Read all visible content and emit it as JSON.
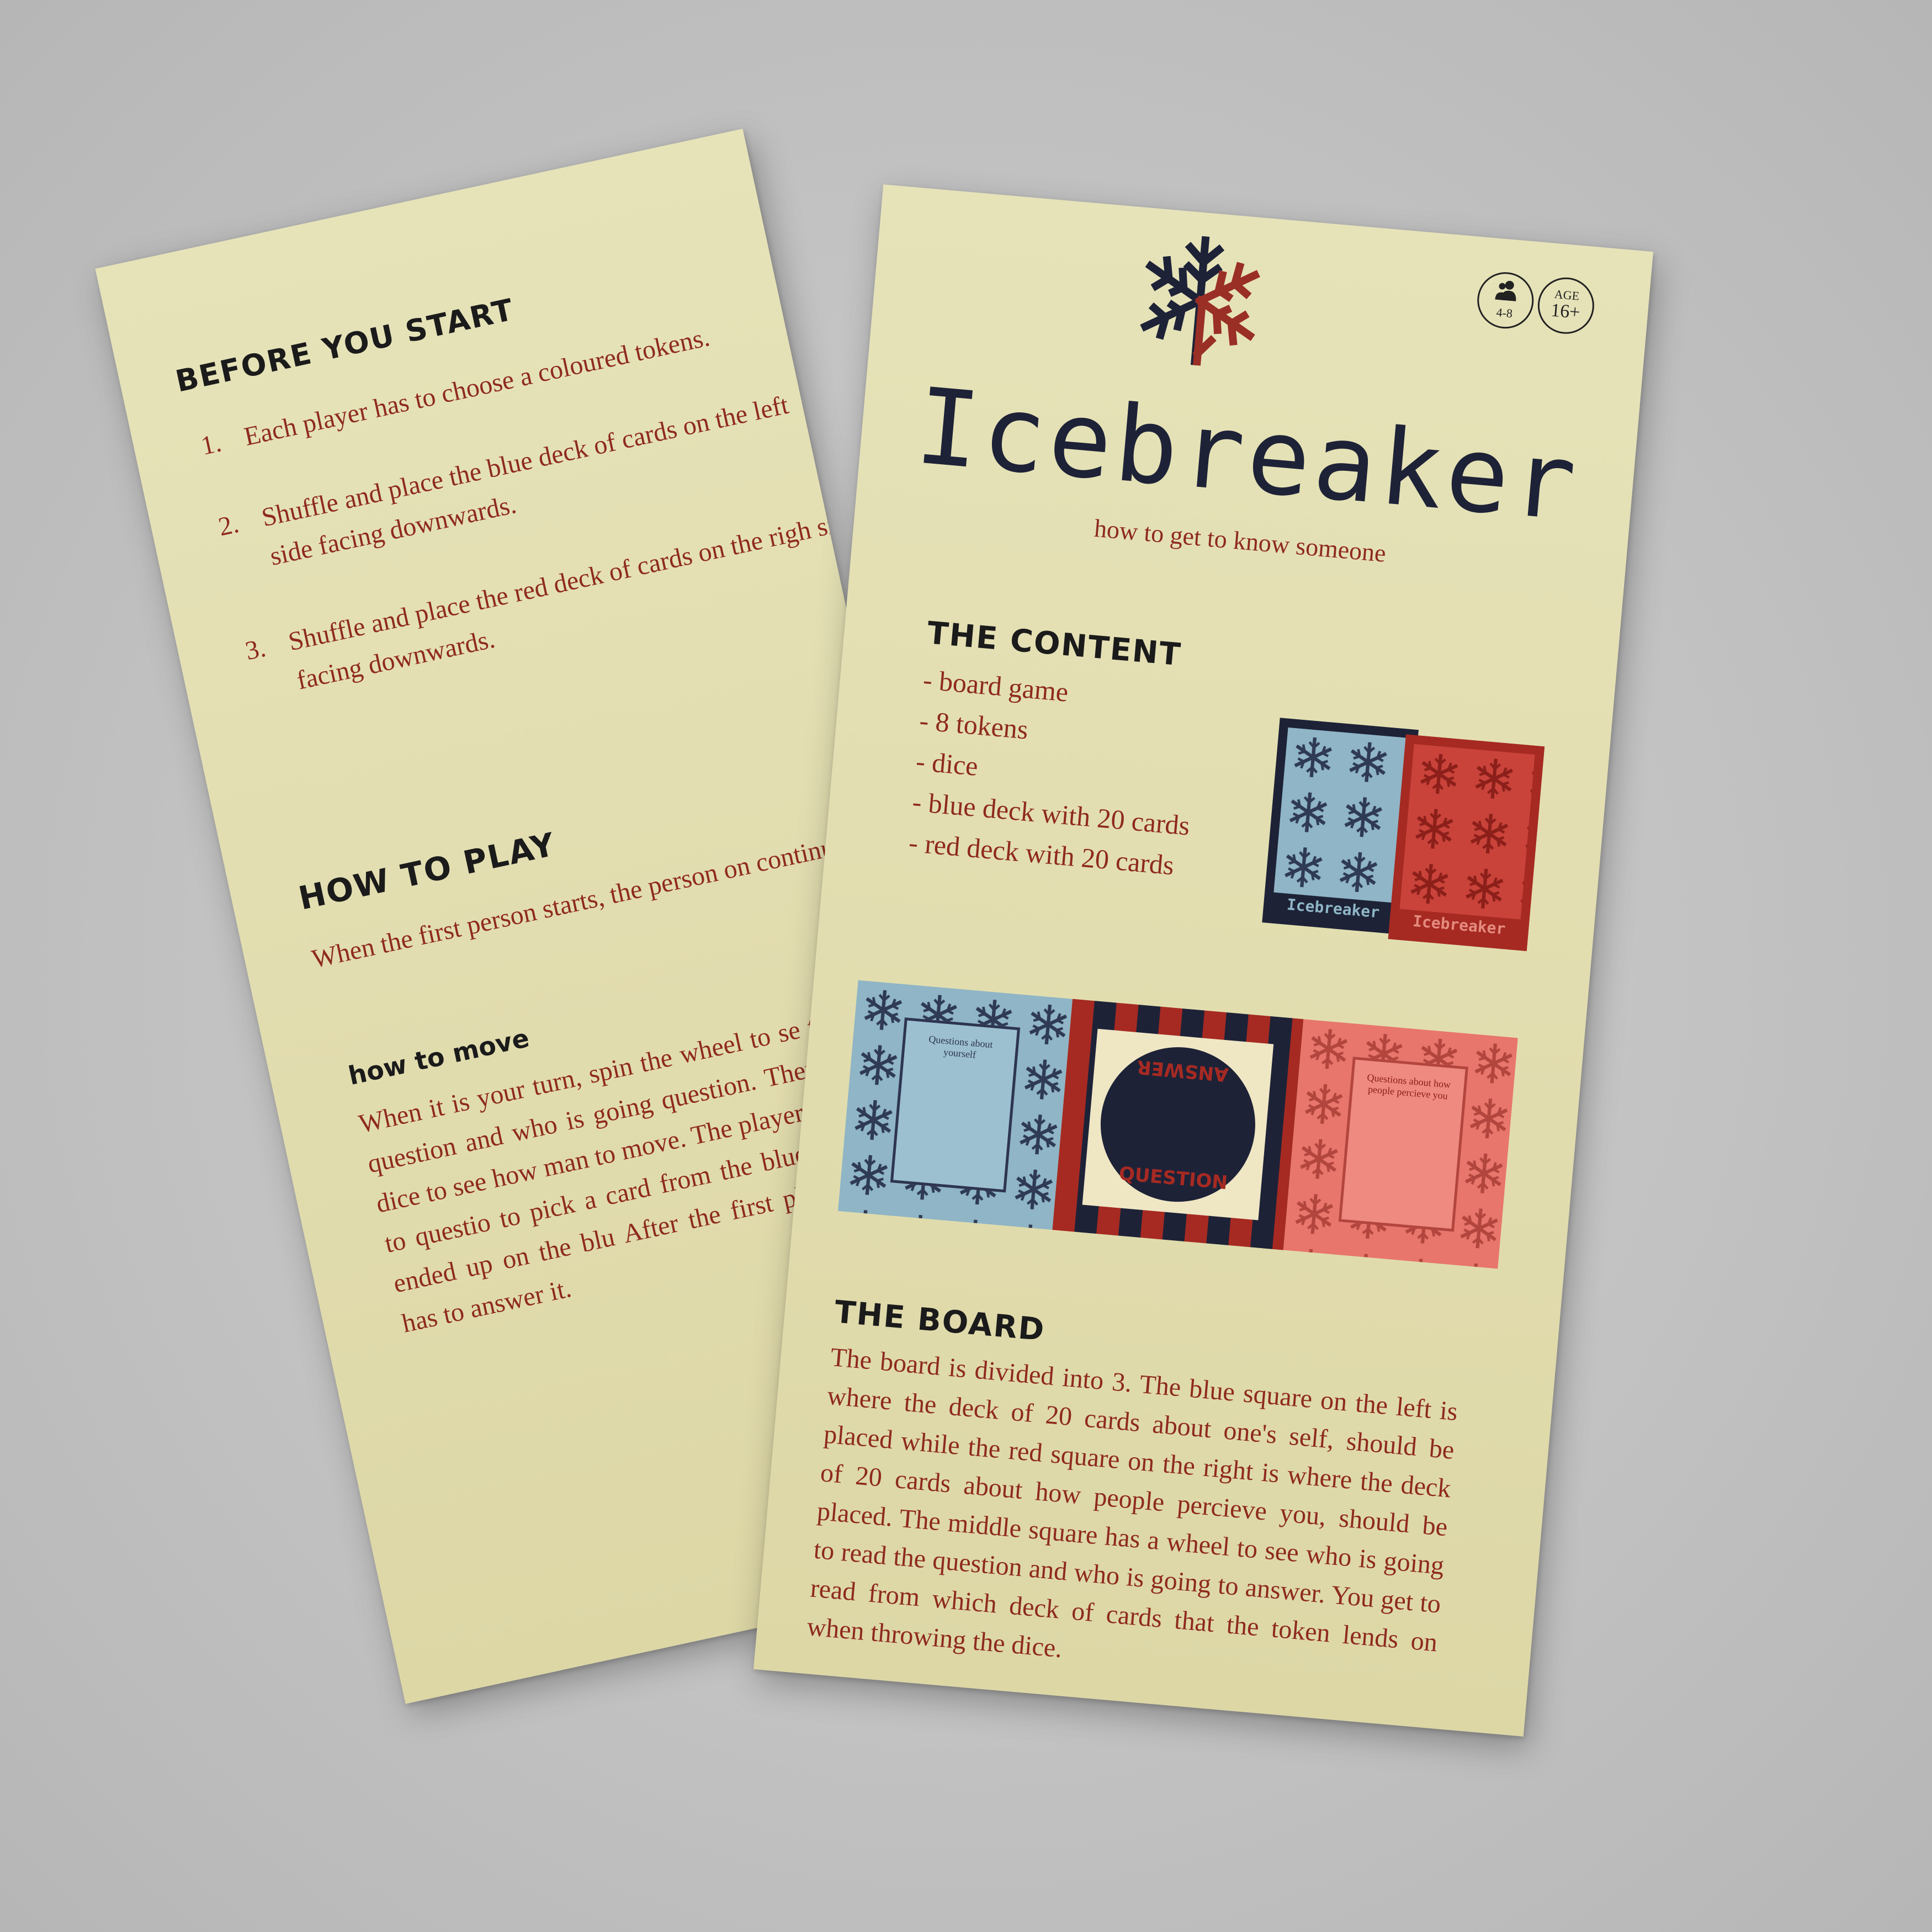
{
  "colors": {
    "background": "#c4c4c4",
    "paper": "#e3dfb3",
    "accent_red": "#8e2a1f",
    "navy": "#1d2237",
    "card_blue": "#8fb5c6",
    "card_red": "#c9433a",
    "board_pink": "#e8766c"
  },
  "back_card": {
    "before_title": "BEFORE YOU START",
    "before_items": [
      {
        "num": "1.",
        "text": "Each player has to choose a coloured tokens."
      },
      {
        "num": "2.",
        "text": "Shuffle and place the blue deck of cards on the left side facing downwards."
      },
      {
        "num": "3.",
        "text": "Shuffle and place the red deck of cards on the righ side facing downwards."
      }
    ],
    "howto_title": "HOW TO PLAY",
    "howto_text": "When the first person starts, the person on continues.",
    "move_title": "how to move",
    "move_text": "When it is your turn, spin the wheel to se to read the question and who is going question. Then throw the dice to see how man to move. The player that is going to questio to pick a card from the blue or the token ended up on the blu After the first player reads the has to answer it."
  },
  "front_card": {
    "logo_icon": "snowflake-icon",
    "players_icon": "people-icon",
    "players": "4-8",
    "age_label": "AGE",
    "age_value": "16+",
    "title": "Icebreaker",
    "subtitle": "how to get to know someone",
    "content_title": "THE CONTENT",
    "content_items": [
      "- board game",
      "- 8 tokens",
      "- dice",
      "- blue deck with 20 cards",
      "- red deck with 20 cards"
    ],
    "deck_label": "Icebreaker",
    "board_left_text": "Questions about yourself",
    "board_right_text": "Questions about how people percieve you",
    "board_answer": "ANSWER",
    "board_question": "QUESTION",
    "board_title": "THE BOARD",
    "board_text": "The board is divided into 3. The blue square on the left is where the deck of 20 cards about one's self, should be placed while the red square on the right is where the deck of 20 cards about how people percieve you, should be placed. The middle square has a wheel to see who is going to read the question and who is going to answer. You get to read from which deck of cards that the token lends on when throwing the dice."
  }
}
